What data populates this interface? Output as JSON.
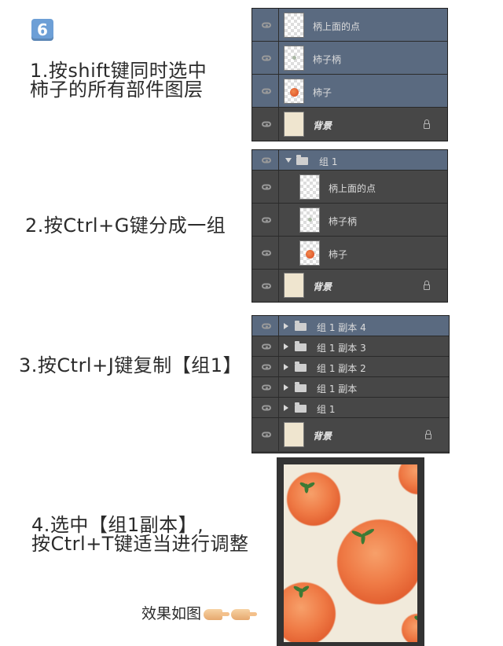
{
  "step_number": "6",
  "steps": [
    {
      "lines": [
        "1.按shift键同时选中",
        "柿子的所有部件图层"
      ]
    },
    {
      "lines": [
        "2.按Ctrl+G键分成一组"
      ]
    },
    {
      "lines": [
        "3.按Ctrl+J键复制【组1】"
      ]
    },
    {
      "lines": [
        "4.选中【组1副本】,",
        "按Ctrl+T键适当进行调整"
      ]
    }
  ],
  "effect_label": "效果如图",
  "panel1": {
    "layers": [
      {
        "name": "柄上面的点",
        "thumb": "transparent",
        "selected": true
      },
      {
        "name": "柿子柄",
        "thumb": "stem",
        "selected": true
      },
      {
        "name": "柿子",
        "thumb": "dot",
        "selected": true
      },
      {
        "name": "背景",
        "thumb": "bg",
        "selected": false,
        "locked": true
      }
    ]
  },
  "panel2": {
    "group_name": "组 1",
    "layers": [
      {
        "name": "柄上面的点",
        "thumb": "transparent"
      },
      {
        "name": "柿子柄",
        "thumb": "stem"
      },
      {
        "name": "柿子",
        "thumb": "dot"
      },
      {
        "name": "背景",
        "thumb": "bg",
        "locked": true
      }
    ]
  },
  "panel3": {
    "groups": [
      {
        "name": "组 1 副本 4",
        "selected": true
      },
      {
        "name": "组 1 副本 3",
        "selected": false
      },
      {
        "name": "组 1 副本 2",
        "selected": false
      },
      {
        "name": "组 1 副本",
        "selected": false
      },
      {
        "name": "组 1",
        "selected": false
      }
    ],
    "background": {
      "name": "背景",
      "locked": true
    }
  },
  "colors": {
    "selected_row": "#5a6a80",
    "badge": "#6d9fd6",
    "persimmon": "#e8652f"
  }
}
